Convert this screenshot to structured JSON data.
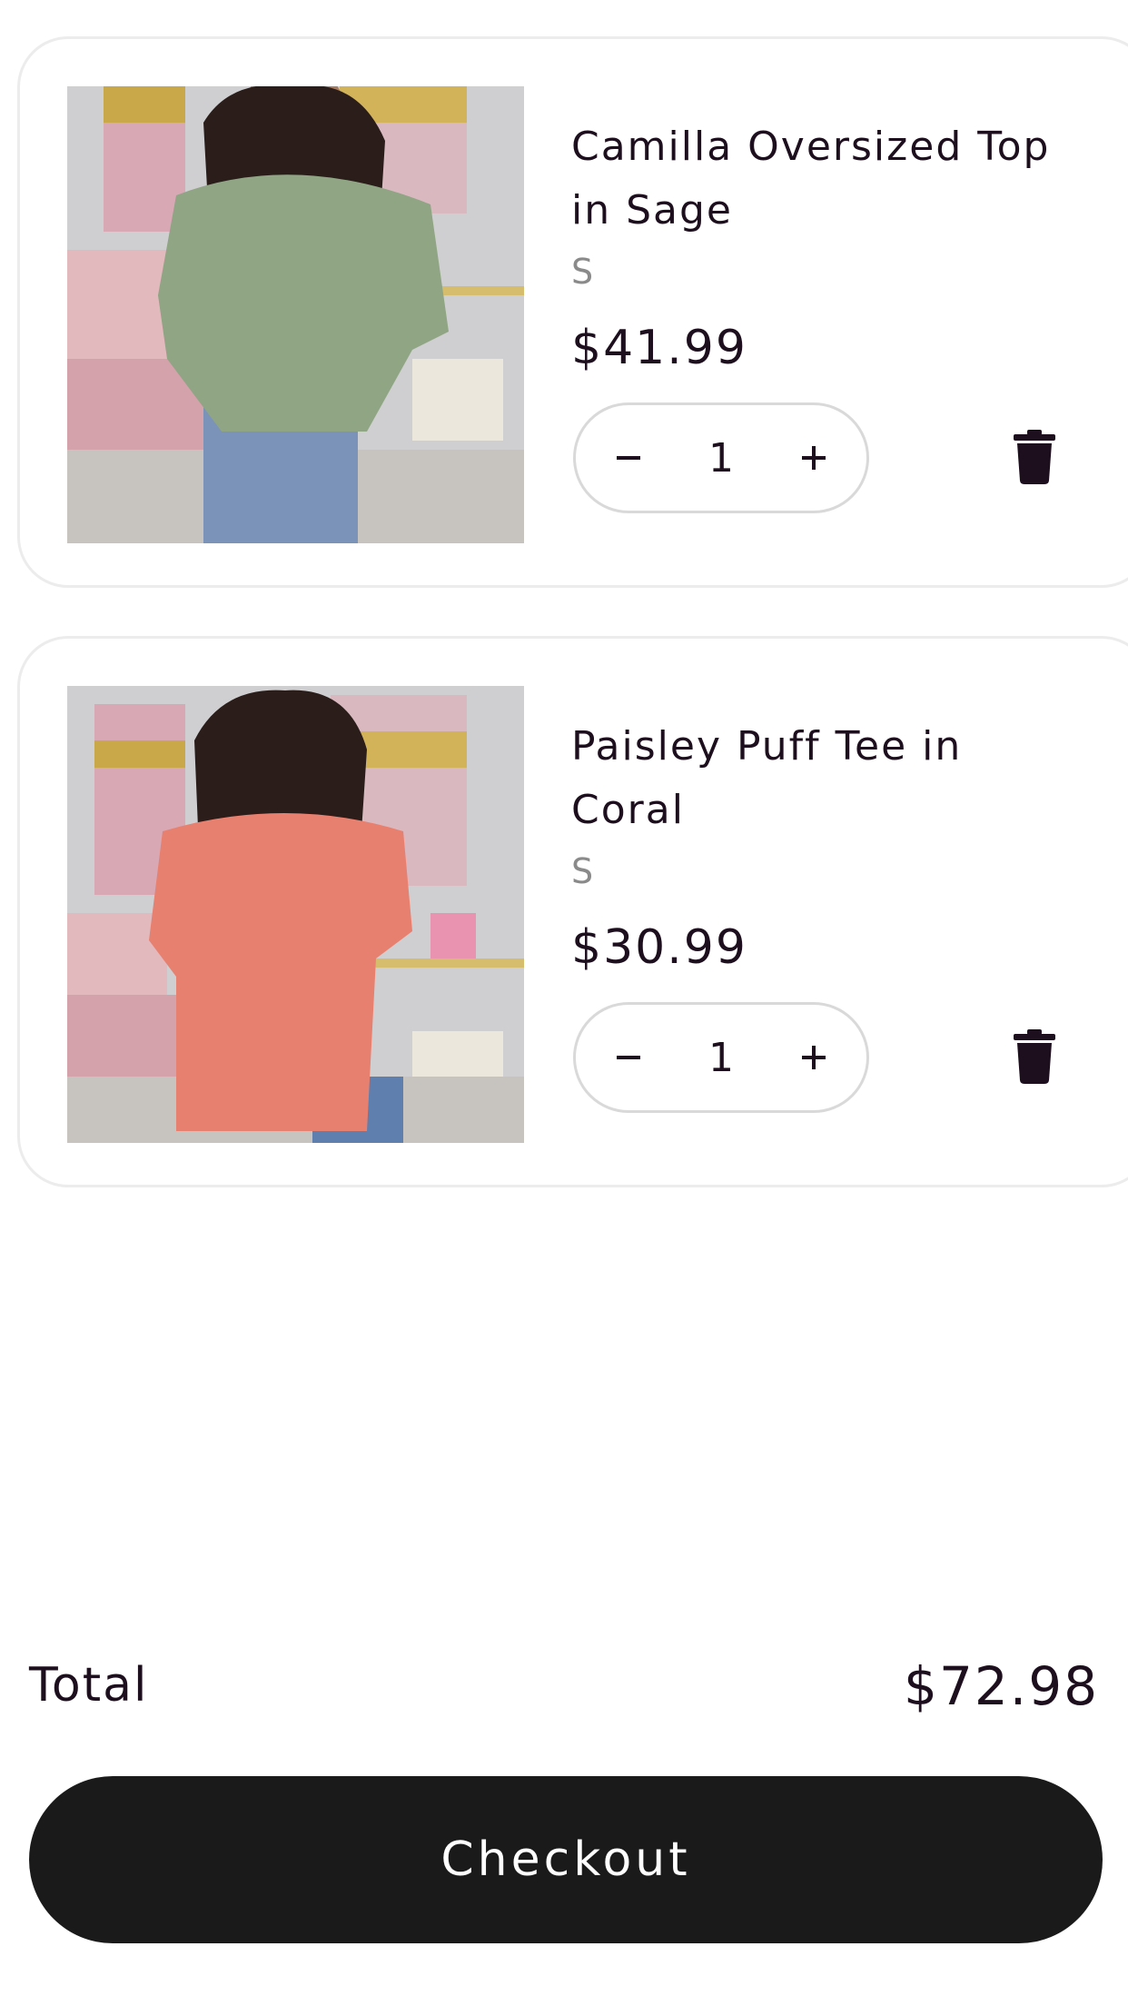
{
  "cart": {
    "items": [
      {
        "title": "Camilla Oversized Top in Sage",
        "variant": "S",
        "price": "$41.99",
        "quantity": "1",
        "image_alt": "Model wearing sage oversized top",
        "shirt_color": "#8fa584"
      },
      {
        "title": "Paisley Puff Tee in Coral",
        "variant": "S",
        "price": "$30.99",
        "quantity": "1",
        "image_alt": "Model wearing coral puff tee",
        "shirt_color": "#e8806f"
      }
    ],
    "icons": {
      "minus": "minus-icon",
      "plus": "plus-icon",
      "remove": "trash-icon"
    }
  },
  "summary": {
    "total_label": "Total",
    "total_value": "$72.98",
    "checkout_label": "Checkout"
  },
  "colors": {
    "text": "#1e0f1e",
    "muted": "#8a8a8a",
    "border": "#ececec",
    "button_bg": "#1a1a1a",
    "button_text": "#ffffff"
  }
}
